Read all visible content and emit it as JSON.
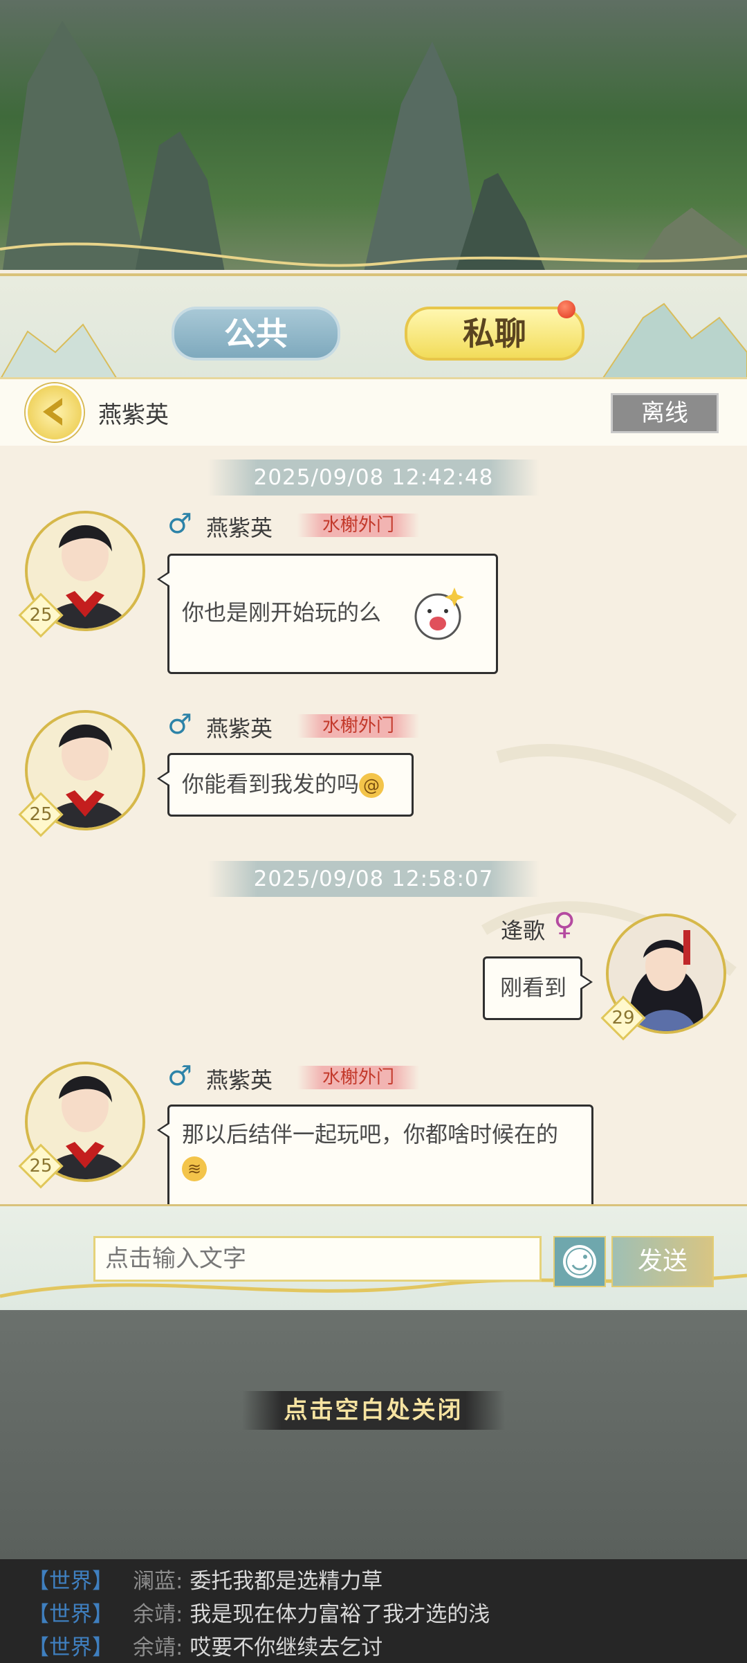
{
  "tabs": {
    "public_label": "公共",
    "private_label": "私聊"
  },
  "header": {
    "contact_name": "燕紫英",
    "status": "离线"
  },
  "messages": [
    {
      "timestamp": "2025/09/08  12:42:48"
    },
    {
      "sender": "燕紫英",
      "level": "25",
      "sect": "水榭外门",
      "text": "你也是刚开始玩的么"
    },
    {
      "sender": "燕紫英",
      "level": "25",
      "sect": "水榭外门",
      "text": "你能看到我发的吗"
    },
    {
      "timestamp": "2025/09/08  12:58:07"
    },
    {
      "sender": "逄歌",
      "level": "29",
      "text": "刚看到"
    },
    {
      "sender": "燕紫英",
      "level": "25",
      "sect": "水榭外门",
      "text_line1": "那以后结伴一起玩吧，你都啥时候在的"
    }
  ],
  "input": {
    "placeholder": "点击输入文字",
    "send_label": "发送"
  },
  "close_hint": "点击空白处关闭",
  "world_chat": [
    {
      "tag": "【世界】",
      "name": "澜蓝:",
      "text": "委托我都是选精力草"
    },
    {
      "tag": "【世界】",
      "name": "余靖:",
      "text": "我是现在体力富裕了我才选的浅"
    },
    {
      "tag": "【世界】",
      "name": "余靖:",
      "text": "哎要不你继续去乞讨"
    }
  ],
  "colors": {
    "accent_gold": "#d6b84a",
    "offline_gray": "#8c8c8c",
    "male_blue": "#2d83a8",
    "female_purple": "#b44aa0"
  }
}
